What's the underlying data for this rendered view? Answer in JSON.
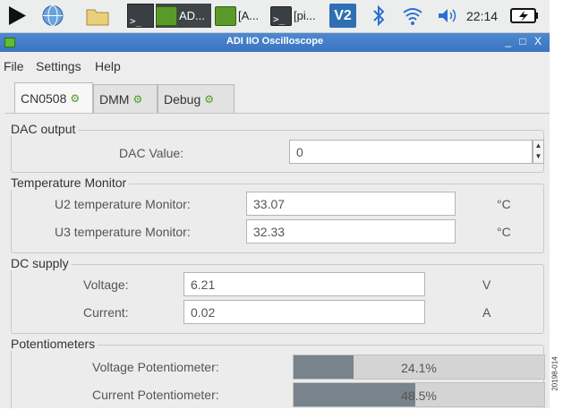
{
  "taskbar": {
    "apps": [
      {
        "label": "AD..."
      },
      {
        "label": "[A..."
      },
      {
        "label": "[pi..."
      }
    ],
    "vnc_label": "V2",
    "clock": "22:14"
  },
  "window": {
    "title": "ADI IIO Oscilloscope",
    "controls": "_ □ X"
  },
  "menu": [
    "File",
    "Settings",
    "Help"
  ],
  "tabs": [
    {
      "label": "CN0508",
      "active": true
    },
    {
      "label": "DMM",
      "active": false
    },
    {
      "label": "Debug",
      "active": false
    }
  ],
  "dac_output": {
    "title": "DAC output",
    "label": "DAC Value:",
    "value": "0"
  },
  "temperature_monitor": {
    "title": "Temperature Monitor",
    "rows": [
      {
        "label": "U2 temperature Monitor:",
        "value": "33.07",
        "unit": "°C"
      },
      {
        "label": "U3 temperature Monitor:",
        "value": "32.33",
        "unit": "°C"
      }
    ]
  },
  "dc_supply": {
    "title": "DC supply",
    "rows": [
      {
        "label": "Voltage:",
        "value": "6.21",
        "unit": "V"
      },
      {
        "label": "Current:",
        "value": "0.02",
        "unit": "A"
      }
    ]
  },
  "potentiometers": {
    "title": "Potentiometers",
    "rows": [
      {
        "label": "Voltage Potentiometer:",
        "percent_text": "24.1%",
        "fraction": 0.241
      },
      {
        "label": "Current Potentiometer:",
        "percent_text": "48.5%",
        "fraction": 0.485
      }
    ]
  },
  "figure_code": "20198-014",
  "colors": {
    "accent": "#3b74bf",
    "progress_fill": "#79838c",
    "tab_icon": "#4c9a22"
  },
  "icons": [
    "raspberry-menu-icon",
    "globe-icon",
    "folder-icon",
    "terminal-icon",
    "oscilloscope-icon",
    "vnc-icon",
    "bluetooth-icon",
    "wifi-icon",
    "volume-icon",
    "battery-icon"
  ]
}
